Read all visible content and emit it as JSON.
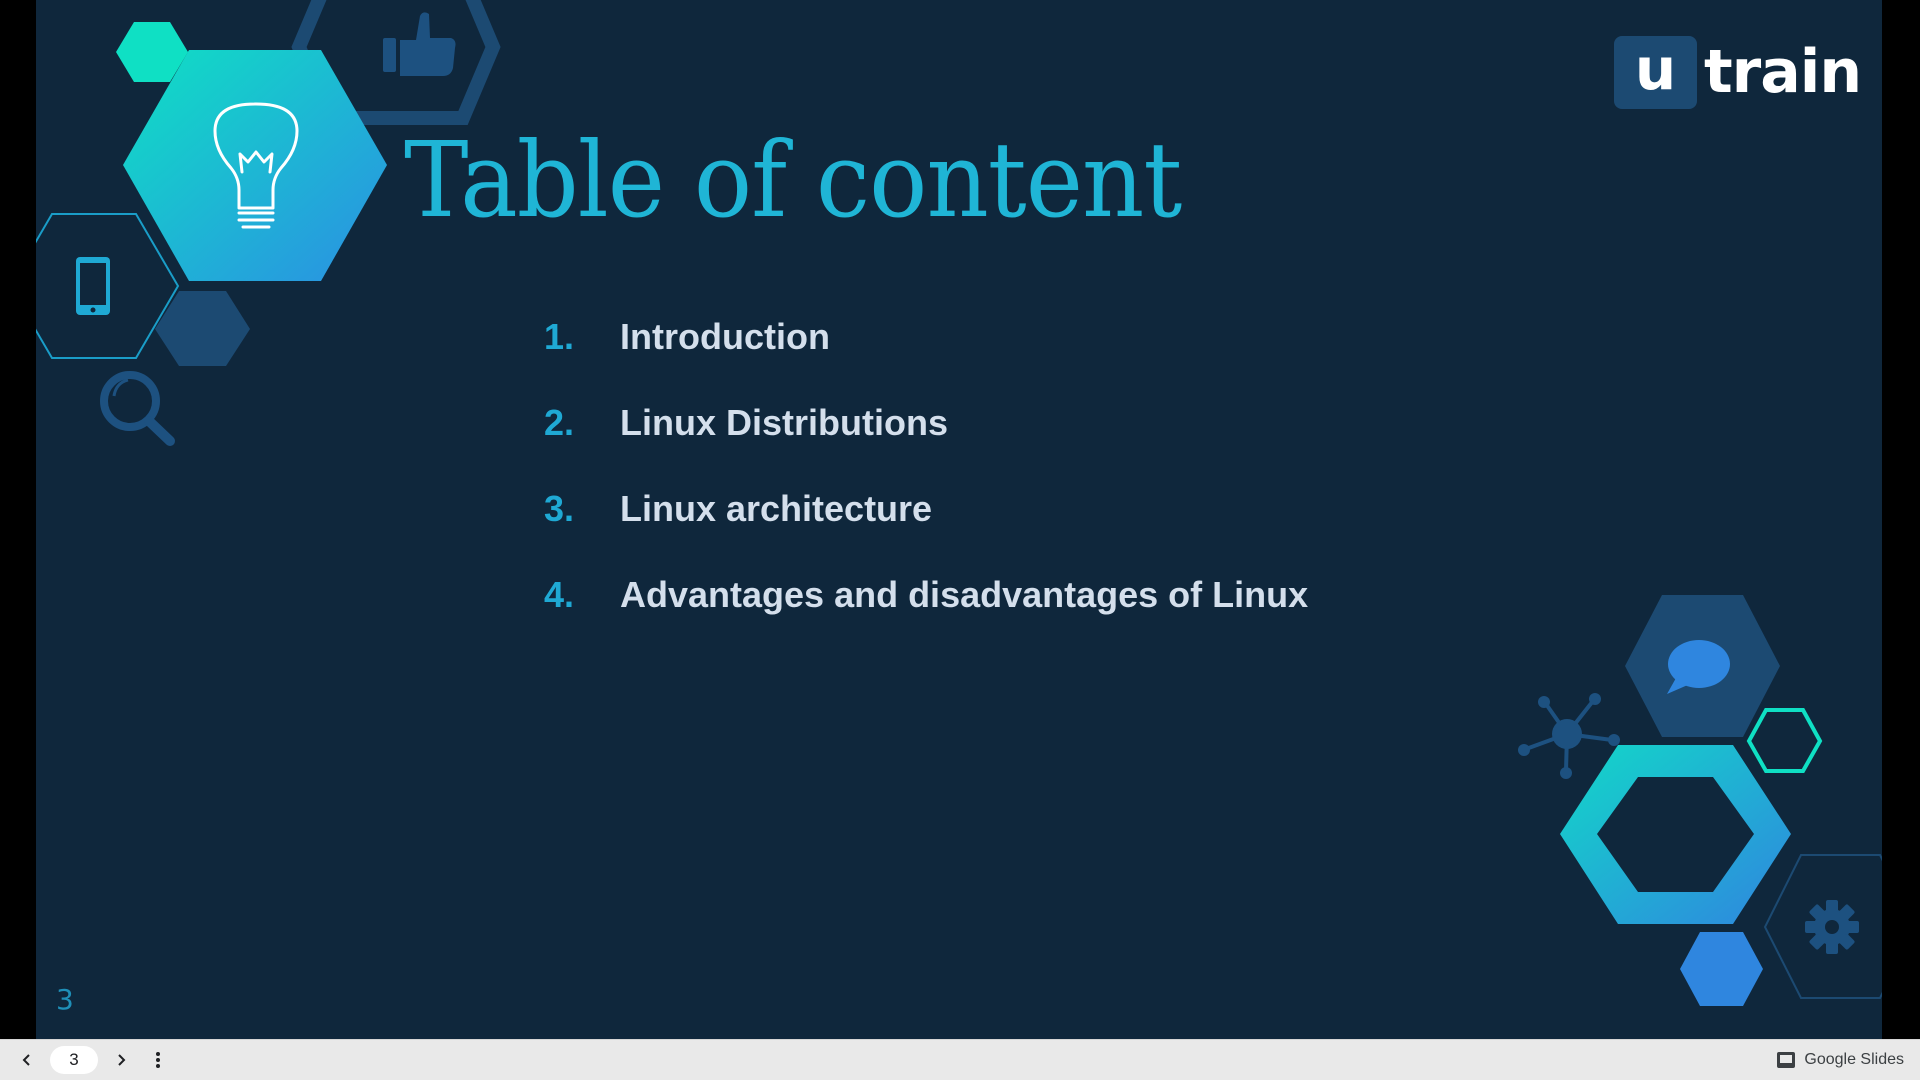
{
  "slide": {
    "title": "Table of content",
    "logo": {
      "mark": "u",
      "text": "train"
    },
    "items": [
      {
        "number": "1.",
        "label": "Introduction"
      },
      {
        "number": "2.",
        "label": "Linux Distributions"
      },
      {
        "number": "3.",
        "label": "Linux architecture"
      },
      {
        "number": "4.",
        "label": "Advantages and disadvantages of Linux"
      }
    ],
    "slide_number": "3",
    "decorative_icons": [
      "lightbulb-icon",
      "thumbs-up-icon",
      "smartphone-icon",
      "magnifier-icon",
      "chat-bubble-icon",
      "network-icon",
      "gear-icon"
    ]
  },
  "toolbar": {
    "prev_icon": "chevron-left-icon",
    "next_icon": "chevron-right-icon",
    "menu_icon": "more-vert-icon",
    "page_value": "3",
    "brand_icon": "slides-icon",
    "brand_label": "Google Slides"
  },
  "colors": {
    "background": "#0f273c",
    "accent_cyan": "#1fb5d6",
    "accent_teal": "#0fe0c4",
    "accent_blue": "#2f86df",
    "dark_hex": "#1c4a72",
    "text_light": "#d4dfec"
  }
}
